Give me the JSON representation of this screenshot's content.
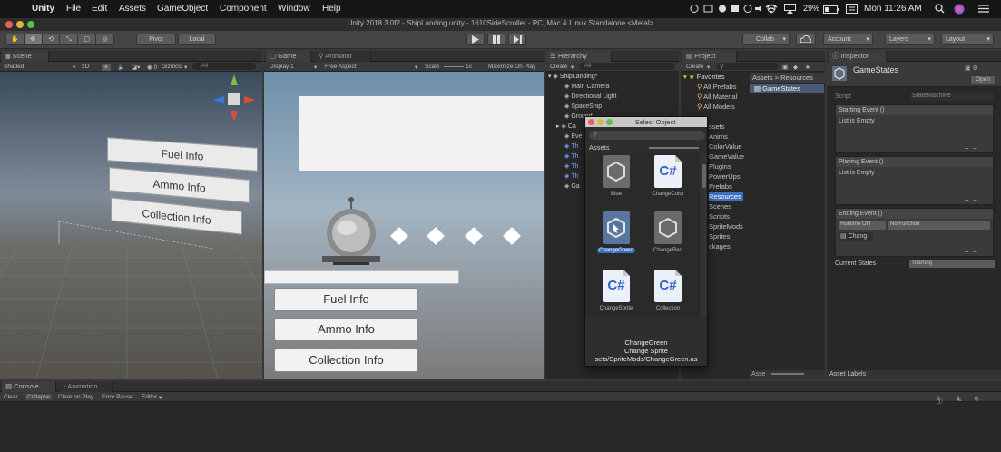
{
  "menubar": {
    "app": "Unity",
    "items": [
      "File",
      "Edit",
      "Assets",
      "GameObject",
      "Component",
      "Window",
      "Help"
    ],
    "battery": "29%",
    "clock": "Mon 11:26 AM"
  },
  "window_title": "Unity 2018.3.0f2 - ShipLanding.unity - 1610SideScroller - PC, Mac & Linux Standalone <Metal>",
  "toolbar": {
    "pivot": "Pivot",
    "local": "Local",
    "collab": "Collab",
    "account": "Account",
    "layers": "Layers",
    "layout": "Layout"
  },
  "scene": {
    "tab": "Scene",
    "shading": "Shaded",
    "mode_2d": "2D",
    "gizmos": "Gizmos",
    "search_placeholder": "All",
    "cards": [
      "Fuel Info",
      "Ammo Info",
      "Collection Info"
    ]
  },
  "game": {
    "tab_game": "Game",
    "tab_animator": "Animator",
    "display": "Display 1",
    "aspect": "Free Aspect",
    "scale_label": "Scale",
    "scale_value": "1x",
    "maximize": "Maximize On Play",
    "buttons": [
      "Fuel Info",
      "Ammo Info",
      "Collection Info"
    ]
  },
  "hierarchy": {
    "tab": "Hierarchy",
    "create": "Create",
    "search_placeholder": "All",
    "scene_name": "ShipLanding*",
    "rows": [
      {
        "label": "Main Camera",
        "blue": false
      },
      {
        "label": "Directional Light",
        "blue": false
      },
      {
        "label": "SpaceShip",
        "blue": false
      },
      {
        "label": "Ground",
        "blue": false
      },
      {
        "label": "Ca",
        "blue": false
      },
      {
        "label": "Eve",
        "blue": false
      },
      {
        "label": "Th",
        "blue": true
      },
      {
        "label": "Th",
        "blue": true
      },
      {
        "label": "Th",
        "blue": true
      },
      {
        "label": "Th",
        "blue": true
      },
      {
        "label": "Ga",
        "blue": false
      }
    ]
  },
  "project": {
    "tab": "Project",
    "create": "Create",
    "favorites": "Favorites",
    "favorite_items": [
      "All Prefabs",
      "All Material",
      "All Models"
    ],
    "breadcrumb_root": "Assets",
    "breadcrumb_leaf": "Resources",
    "selected_asset": "GameStates",
    "folder_partial_header": "ssets",
    "folders": [
      "Anims",
      "ColorValue",
      "GameValue",
      "Plugins",
      "PowerUps",
      "Prefabs",
      "Resources",
      "Scenes",
      "Scripts",
      "SpriteMods",
      "Sprites",
      "ckages"
    ],
    "footer": "Asse"
  },
  "inspector": {
    "tab": "Inspector",
    "object_name": "GameStates",
    "open": "Open",
    "script_label": "Script",
    "script_value": "StateMachine",
    "events": [
      {
        "title": "Starting Event ()",
        "body": "List is Empty"
      },
      {
        "title": "Playing Event ()",
        "body": "List is Empty"
      }
    ],
    "ending_event": {
      "title": "Ending Event ()",
      "runtime": "Runtime Onl",
      "function": "No Function",
      "object": "Chang"
    },
    "current_states_label": "Current States",
    "current_states_value": "Starting",
    "asset_labels": "Asset Labels"
  },
  "select_dialog": {
    "title": "Select Object",
    "section": "Assets",
    "assets": [
      {
        "name": "Blue",
        "kind": "unity"
      },
      {
        "name": "ChangeColor",
        "kind": "cs"
      },
      {
        "name": "ChangeGreen",
        "kind": "unity"
      },
      {
        "name": "ChangeRed",
        "kind": "unity"
      },
      {
        "name": "ChangeSprite",
        "kind": "cs"
      },
      {
        "name": "Collection",
        "kind": "cs"
      }
    ],
    "info_name": "ChangeGreen",
    "info_type": "Change Sprite",
    "info_path": "sets/SpriteMods/ChangeGreen.as",
    "cs_glyph": "C#"
  },
  "console": {
    "tab_console": "Console",
    "tab_animation": "Animation",
    "buttons": [
      "Clear",
      "Collapse",
      "Clear on Play",
      "Error Pause",
      "Editor"
    ],
    "count_info": "0",
    "count_warn": "1",
    "count_error": "0"
  },
  "colors": {
    "accent": "#3d6fc4",
    "panel": "#282828",
    "toolbar": "#444444"
  }
}
